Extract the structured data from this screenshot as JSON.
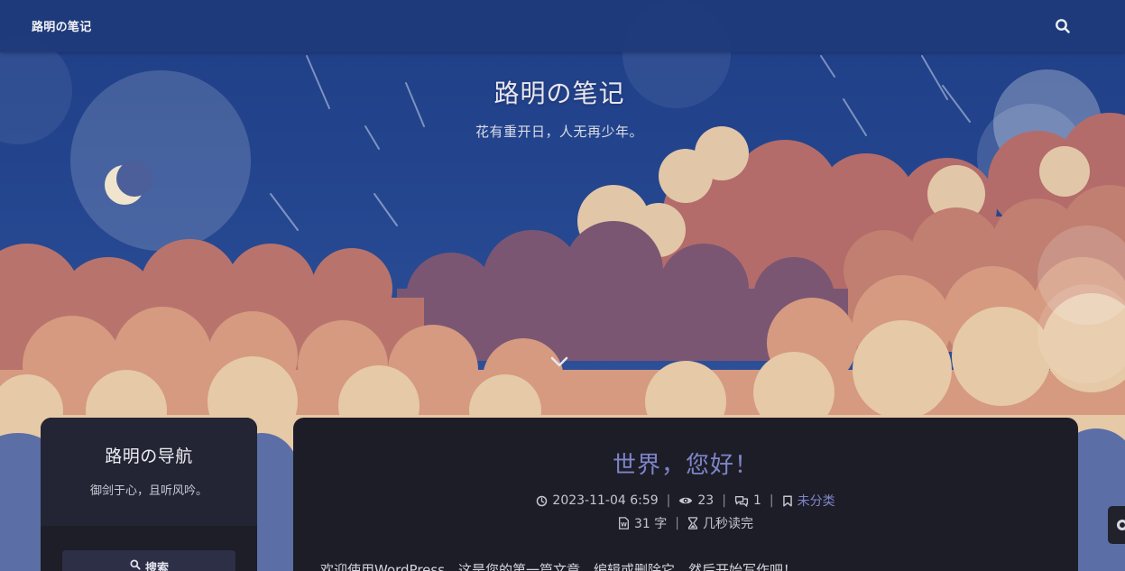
{
  "navbar": {
    "brand": "路明の笔记",
    "search_icon": "search-icon"
  },
  "hero": {
    "title": "路明の笔记",
    "tagline": "花有重开日，人无再少年。",
    "scroll_icon": "chevron-down-icon"
  },
  "sidebar": {
    "title": "路明の导航",
    "subtitle": "御剑于心，且听风吟。",
    "search_label": "搜索"
  },
  "post": {
    "title": "世界，您好！",
    "date": "2023-11-04 6:59",
    "views": "23",
    "comments": "1",
    "category": "未分类",
    "word_count": "31 字",
    "read_time": "几秒读完",
    "excerpt": "欢迎使用WordPress。这是您的第一篇文章。编辑或删除它，然后开始写作吧！"
  },
  "colors": {
    "accent": "#7e85c9",
    "navbar": "#1e3a7a",
    "card": "#1d1d27"
  }
}
